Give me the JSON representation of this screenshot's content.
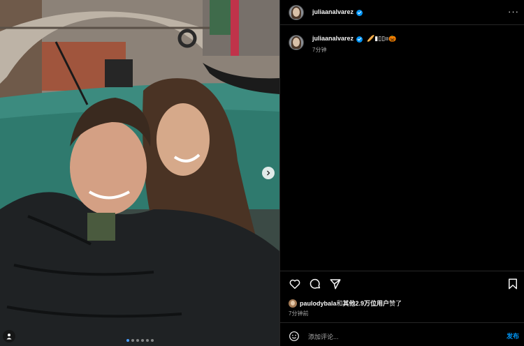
{
  "post": {
    "username": "juliaanalvarez",
    "verified": true,
    "caption_emojis": "🥖▮▯▯ıı🎃",
    "caption_time": "7分钟",
    "media": {
      "carousel_dots": 6,
      "active_dot": 0,
      "next_icon": "chevron-right-icon",
      "user_tag_icon": "person-icon"
    },
    "likes": {
      "liker": "paulodybala",
      "connector": "和",
      "others": "其他2.9万位用户",
      "suffix": "赞了"
    },
    "posted_ago": "7分钟前",
    "comment": {
      "placeholder": "添加评论...",
      "post_label": "发布"
    }
  },
  "colors": {
    "background": "#000000",
    "accent": "#0095f6",
    "muted": "#a8a8a8",
    "border": "#262626"
  }
}
